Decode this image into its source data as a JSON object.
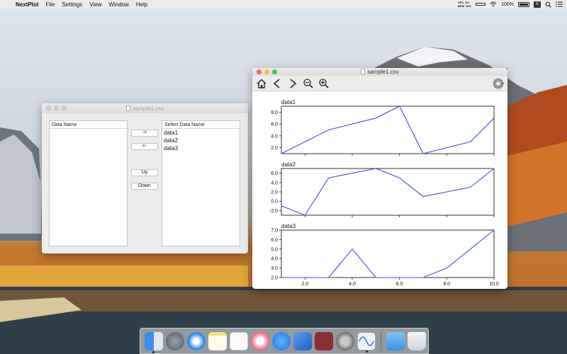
{
  "menubar": {
    "apple_glyph": "",
    "app_name": "NextPlot",
    "menus": [
      "File",
      "Settings",
      "View",
      "Window",
      "Help"
    ],
    "cpu_label": "CPU",
    "cpu_value": "6%",
    "mem_label": "MEM",
    "mem_value": "33%",
    "battery_percent": "100%",
    "input_source": "A"
  },
  "selector_window": {
    "title": "sample1.csv",
    "left_list_header": "Data Name",
    "left_items": [],
    "right_list_header": "Select Data Name",
    "right_items": [
      "data1",
      "data2",
      "data3"
    ],
    "buttons": {
      "add": "->",
      "remove": "<-",
      "up": "Up",
      "down": "Down"
    }
  },
  "plot_window": {
    "title": "sample1.csv",
    "toolbar_icons": [
      "home-icon",
      "back-icon",
      "forward-icon",
      "zoom-out-icon",
      "zoom-in-icon",
      "settings-gear-icon"
    ]
  },
  "chart_data": [
    {
      "type": "line",
      "title": "data1",
      "x": [
        1,
        2,
        3,
        4,
        5,
        6,
        7,
        8,
        9,
        10
      ],
      "series": [
        {
          "values": [
            1.0,
            3.0,
            5.0,
            6.0,
            7.0,
            9.0,
            1.0,
            2.0,
            3.0,
            7.0
          ]
        }
      ],
      "xlim": [
        1,
        10
      ],
      "ylim": [
        1.0,
        9.0
      ],
      "yticks": [
        "2.0",
        "4.0",
        "6.0",
        "8.0"
      ],
      "xticks": [],
      "color": "#3a4fe0"
    },
    {
      "type": "line",
      "title": "data2",
      "x": [
        1,
        2,
        3,
        4,
        5,
        6,
        7,
        8,
        9,
        10
      ],
      "series": [
        {
          "values": [
            -1.0,
            -3.0,
            5.0,
            6.0,
            7.0,
            5.0,
            1.0,
            2.0,
            3.0,
            7.0
          ]
        }
      ],
      "xlim": [
        1,
        10
      ],
      "ylim": [
        -3.0,
        7.0
      ],
      "yticks": [
        "-2.0",
        "0.0",
        "2.0",
        "4.0",
        "6.0"
      ],
      "xticks": [],
      "color": "#3a4fe0"
    },
    {
      "type": "line",
      "title": "data3",
      "x": [
        1,
        2,
        3,
        4,
        5,
        6,
        7,
        8,
        9,
        10
      ],
      "series": [
        {
          "values": [
            2.0,
            2.0,
            2.0,
            5.0,
            2.0,
            2.0,
            2.0,
            3.0,
            5.0,
            7.0
          ]
        }
      ],
      "xlim": [
        1,
        10
      ],
      "ylim": [
        2.0,
        7.0
      ],
      "yticks": [
        "2.0",
        "3.0",
        "4.0",
        "5.0",
        "6.0",
        "7.0"
      ],
      "xticks": [
        "2.0",
        "4.0",
        "6.0",
        "8.0",
        "10.0"
      ],
      "color": "#3a4fe0"
    }
  ],
  "dock": {
    "apps": [
      "finder-icon",
      "launchpad-icon",
      "safari-icon",
      "notes-icon",
      "textedit-icon",
      "music-icon",
      "app-store-icon",
      "xcode-icon",
      "dictionary-icon",
      "system-preferences-icon",
      "nextplot-icon"
    ],
    "right": [
      "downloads-folder-icon",
      "trash-icon"
    ]
  }
}
